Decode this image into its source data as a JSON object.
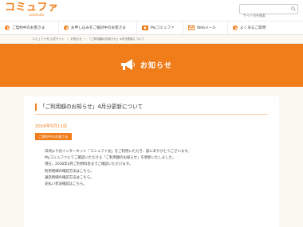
{
  "header": {
    "logo": "コミュファ",
    "logo_sub": "commufa",
    "search_placeholder": "サイト内を検索"
  },
  "nav": {
    "items": [
      {
        "label": "ご契約中のお客さま"
      },
      {
        "label": "お申し込みをご検討中のお客さま"
      },
      {
        "label": "Myコミュファ"
      },
      {
        "label": "Webメール"
      },
      {
        "label": "よくあるご質問"
      }
    ]
  },
  "breadcrumb": [
    "コミュファ光 公式サイト",
    "›",
    "お知らせ",
    "›",
    "「ご利用額のお知らせ」4月分更新について"
  ],
  "hero": {
    "title": "お知らせ"
  },
  "notice": {
    "title": "「ご利用額のお知らせ」4月分更新について",
    "date": "2016年5月11日",
    "badge": "ご契約中のお客さま",
    "paragraphs": [
      "日頃より光インターネット「コミュファ光」をご利用いただき、誠にありがとうございます。",
      "Myコミュファにてご確認いただける「ご利用額のお知らせ」を更新いたしました。",
      "",
      "現在、2016年4月ご利用料金までご確認いただけます。",
      "",
      "",
      "利用明細の確認方法はこちら。",
      "",
      "通話明細の確認方法はこちら。",
      "",
      "支払い状況確認はこちら。"
    ]
  },
  "colors": {
    "accent": "#f07d1a",
    "background": "#fbf8f2"
  },
  "icons": {
    "hero": "megaphone-icon",
    "search": "search-icon"
  }
}
